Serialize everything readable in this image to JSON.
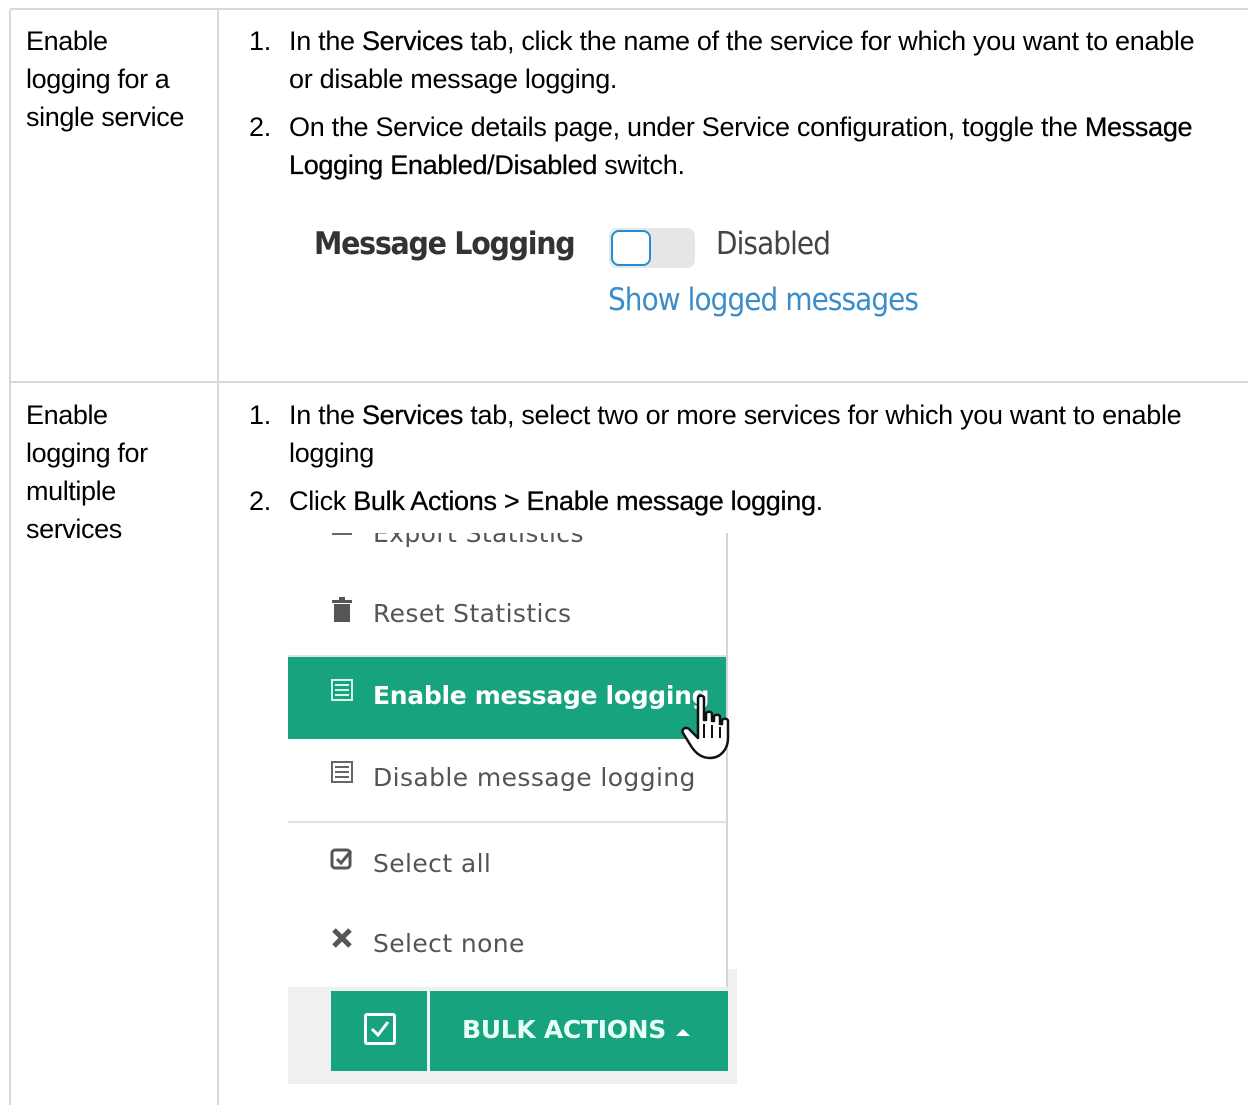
{
  "rows": [
    {
      "task_lines": [
        "Enable",
        "logging for a",
        "single service"
      ],
      "steps": [
        {
          "num": "1.",
          "parts": [
            {
              "t": "In the ",
              "b": false
            },
            {
              "t": "Services",
              "b": true
            },
            {
              "t": " tab, click the name of the service for which you want to enable or disable message logging.",
              "b": false
            }
          ]
        },
        {
          "num": "2.",
          "parts": [
            {
              "t": "On the Service details page, under Service configuration, toggle the ",
              "b": false
            },
            {
              "t": "Message Logging Enabled/Disabled",
              "b": true
            },
            {
              "t": " switch.",
              "b": false
            }
          ]
        }
      ]
    },
    {
      "task_lines": [
        "Enable",
        "logging for",
        "multiple",
        "services"
      ],
      "steps": [
        {
          "num": "1.",
          "parts": [
            {
              "t": "In the ",
              "b": false
            },
            {
              "t": "Services",
              "b": true
            },
            {
              "t": " tab, select two or more services for which you want to enable logging",
              "b": false
            }
          ]
        },
        {
          "num": "2.",
          "parts": [
            {
              "t": "Click ",
              "b": false
            },
            {
              "t": "Bulk Actions > Enable message logging",
              "b": true
            },
            {
              "t": ".",
              "b": false
            }
          ]
        }
      ]
    }
  ],
  "message_logging": {
    "label": "Message Logging",
    "state": "Disabled",
    "enabled": false,
    "link": "Show logged messages"
  },
  "bulk_menu": {
    "items": [
      {
        "label": "Export Statistics",
        "icon": "export-icon"
      },
      {
        "label": "Reset Statistics",
        "icon": "trash-icon"
      },
      {
        "label": "Enable message logging",
        "icon": "log-icon",
        "active": true
      },
      {
        "label": "Disable message logging",
        "icon": "log-icon"
      },
      {
        "label": "Select all",
        "icon": "check-square-icon"
      },
      {
        "label": "Select none",
        "icon": "x-icon"
      }
    ],
    "button_label": "BULK ACTIONS",
    "accent": "#16a37d"
  }
}
